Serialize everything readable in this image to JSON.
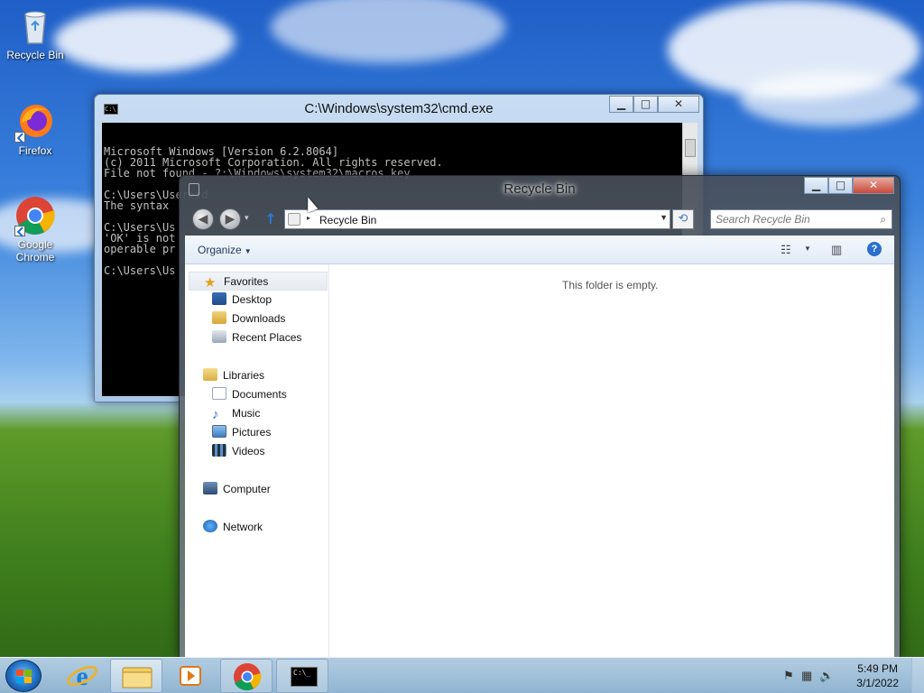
{
  "desktop": {
    "icons": [
      {
        "label": "Recycle Bin",
        "icon": "recycle-bin-icon"
      },
      {
        "label": "Firefox",
        "icon": "firefox-icon"
      },
      {
        "label": "Google Chrome",
        "icon": "chrome-icon"
      }
    ]
  },
  "cmd_window": {
    "title": "C:\\Windows\\system32\\cmd.exe",
    "icon_text": "C:\\",
    "controls": {
      "minimize": "▁",
      "maximize": "□",
      "close": "✕"
    },
    "lines": [
      "Microsoft Windows [Version 6.2.8064]",
      "(c) 2011 Microsoft Corporation. All rights reserved.",
      "File not found - ?:\\Windows\\system32\\macros.key",
      "",
      "C:\\Users\\User>rd",
      "The syntax",
      "",
      "C:\\Users\\Us",
      "'OK' is not",
      "operable pr",
      "",
      "C:\\Users\\Us"
    ]
  },
  "explorer": {
    "title": "Recycle Bin",
    "controls": {
      "minimize": "▁",
      "maximize": "□",
      "close": "✕"
    },
    "nav": {
      "back": "◀",
      "forward": "▶",
      "up": "↑",
      "recent_dd": "▾"
    },
    "address": {
      "arrow": "▸",
      "path": "Recycle Bin",
      "dropdown": "▼"
    },
    "refresh_icon": "⟲",
    "search": {
      "placeholder": "Search Recycle Bin",
      "icon": "⌕"
    },
    "command_bar": {
      "organize": "Organize",
      "organize_dd": "▼",
      "view_icon": "☷",
      "view_dd": "▼",
      "preview_icon": "▥",
      "help": "?"
    },
    "nav_pane": {
      "favorites": {
        "label": "Favorites",
        "items": [
          "Desktop",
          "Downloads",
          "Recent Places"
        ]
      },
      "libraries": {
        "label": "Libraries",
        "items": [
          "Documents",
          "Music",
          "Pictures",
          "Videos"
        ]
      },
      "computer": "Computer",
      "network": "Network"
    },
    "empty_message": "This folder is empty."
  },
  "taskbar": {
    "pinned": [
      "internet-explorer-icon",
      "file-explorer-icon",
      "media-player-icon",
      "chrome-icon",
      "cmd-icon"
    ],
    "clock": {
      "time": "5:49 PM",
      "date": "3/1/2022"
    },
    "tray_icons": {
      "flag": "⚑",
      "network": "▦",
      "volume": "🔊"
    },
    "cmd_icon_text": "C:\\_"
  },
  "colors": {
    "accent": "#2a6fd0",
    "cmd_bg": "#000000",
    "cmd_fg": "#c0c0c0"
  }
}
